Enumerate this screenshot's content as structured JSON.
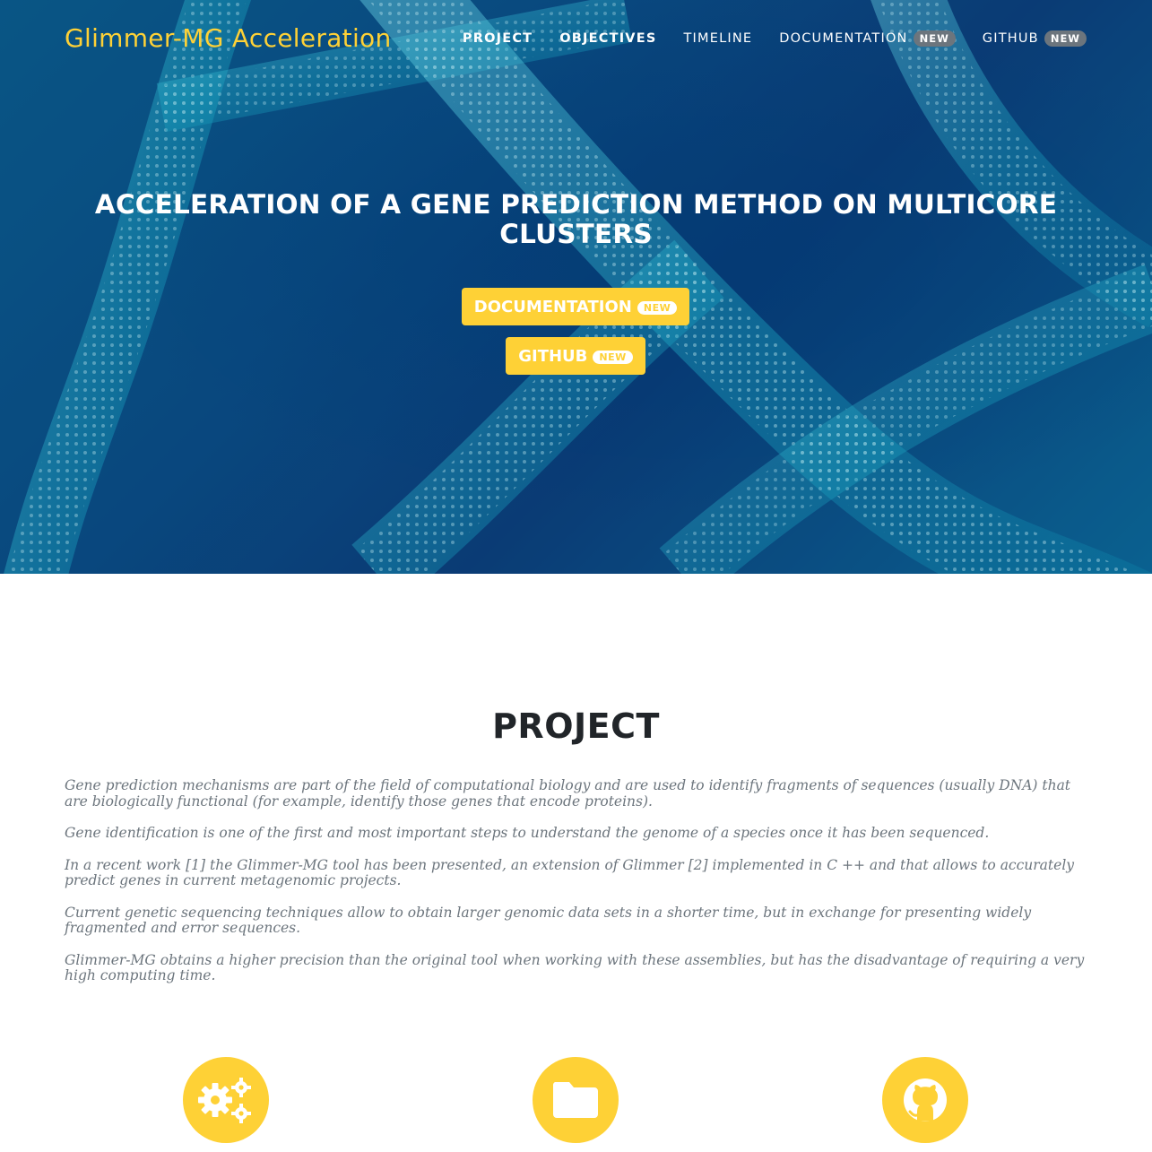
{
  "brand": "Glimmer-MG Acceleration",
  "nav": [
    {
      "label": "PROJECT",
      "badge": ""
    },
    {
      "label": "OBJECTIVES",
      "badge": ""
    },
    {
      "label": "TIMELINE",
      "badge": ""
    },
    {
      "label": "DOCUMENTATION",
      "badge": "NEW"
    },
    {
      "label": "GITHUB",
      "badge": "NEW"
    }
  ],
  "hero": {
    "title": "ACCELERATION OF A GENE PREDICTION METHOD ON MULTICORE CLUSTERS",
    "buttons": [
      {
        "label": "DOCUMENTATION",
        "badge": "NEW"
      },
      {
        "label": "GITHUB",
        "badge": "NEW"
      }
    ]
  },
  "project": {
    "title": "PROJECT",
    "paragraphs": [
      "Gene prediction mechanisms are part of the field of computational biology and are used to identify fragments of sequences (usually DNA) that are biologically functional (for example, identify those genes that encode proteins).",
      "Gene identification is one of the first and most important steps to understand the genome of a species once it has been sequenced.",
      "In a recent work [1] the Glimmer-MG tool has been presented, an extension of Glimmer [2] implemented in C ++ and that allows to accurately predict genes in current metagenomic projects.",
      "Current genetic sequencing techniques allow to obtain larger genomic data sets in a shorter time, but in exchange for presenting widely fragmented and error sequences.",
      "Glimmer-MG obtains a higher precision than the original tool when working with these assemblies, but has the disadvantage of requiring a very high computing time."
    ]
  },
  "features": [
    {
      "icon": "gears-icon"
    },
    {
      "icon": "folder-icon"
    },
    {
      "icon": "github-icon"
    }
  ],
  "colors": {
    "accent": "#fed136",
    "hero_dark": "#0b3f7a",
    "hero_cyan": "#2fd6e6",
    "badge": "#6c757d"
  }
}
